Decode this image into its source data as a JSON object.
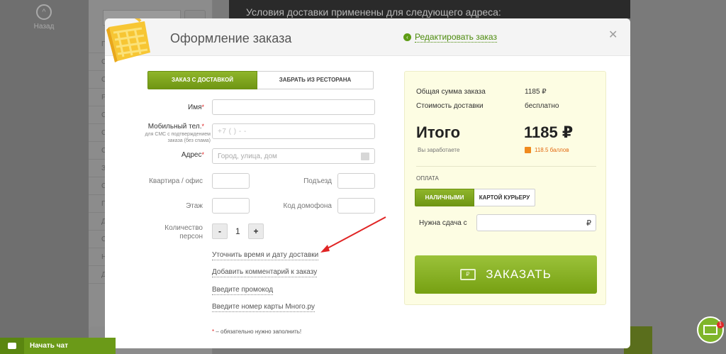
{
  "background": {
    "back_label": "Назад",
    "banner_text": "Условия доставки применены для следующего адреса:",
    "side_letters": [
      "П",
      "С",
      "С",
      "Р",
      "С",
      "С",
      "С",
      "З",
      "С",
      "П",
      "Д",
      "С",
      "Н",
      "Д"
    ]
  },
  "modal": {
    "title": "Оформление заказа",
    "edit_link": "Редактировать заказ",
    "close": "✕"
  },
  "tabs": {
    "delivery": "Заказ с доставкой",
    "pickup": "Забрать из ресторана"
  },
  "form": {
    "name_label": "Имя",
    "phone_label": "Мобильный тел.",
    "phone_note": "для СМС с подтверждением\nзаказа (без спама)",
    "phone_placeholder": "+7 (    )    -   -",
    "address_label": "Адрес",
    "address_placeholder": "Город, улица, дом",
    "apartment_label": "Квартира / офис",
    "entrance_label": "Подъезд",
    "floor_label": "Этаж",
    "intercom_label": "Код домофона",
    "persons_label": "Количество\nперсон",
    "persons_value": "1",
    "minus": "-",
    "plus": "+",
    "required_mark": "*"
  },
  "links": {
    "delivery_time": "Уточнить время и дату доставки",
    "comment": "Добавить комментарий к заказу",
    "promo": "Введите промокод",
    "card": "Введите номер карты Много.ру"
  },
  "footnote": "– обязательно нужно заполнить!",
  "summary": {
    "order_sum_label": "Общая сумма заказа",
    "order_sum_value": "1185 ₽",
    "delivery_label": "Стоимость доставки",
    "delivery_value": "бесплатно",
    "total_label": "Итого",
    "total_value": "1185 ₽",
    "earn_label": "Вы заработаете",
    "bonus_value": "118.5 баллов",
    "payment_heading": "Оплата",
    "pay_cash": "наличными",
    "pay_card": "картой курьеру",
    "change_label": "Нужна сдача с",
    "ruble": "₽",
    "order_button": "ЗАКАЗАТЬ",
    "order_icon": "₽"
  },
  "chat": {
    "label": "Начать чат"
  },
  "mail": {
    "badge": "1"
  },
  "colors": {
    "accent_green": "#7aa31a",
    "link_green": "#4b8a0b",
    "bonus_orange": "#e36a12",
    "required_red": "#d22222",
    "summary_bg": "#fdfde3"
  }
}
